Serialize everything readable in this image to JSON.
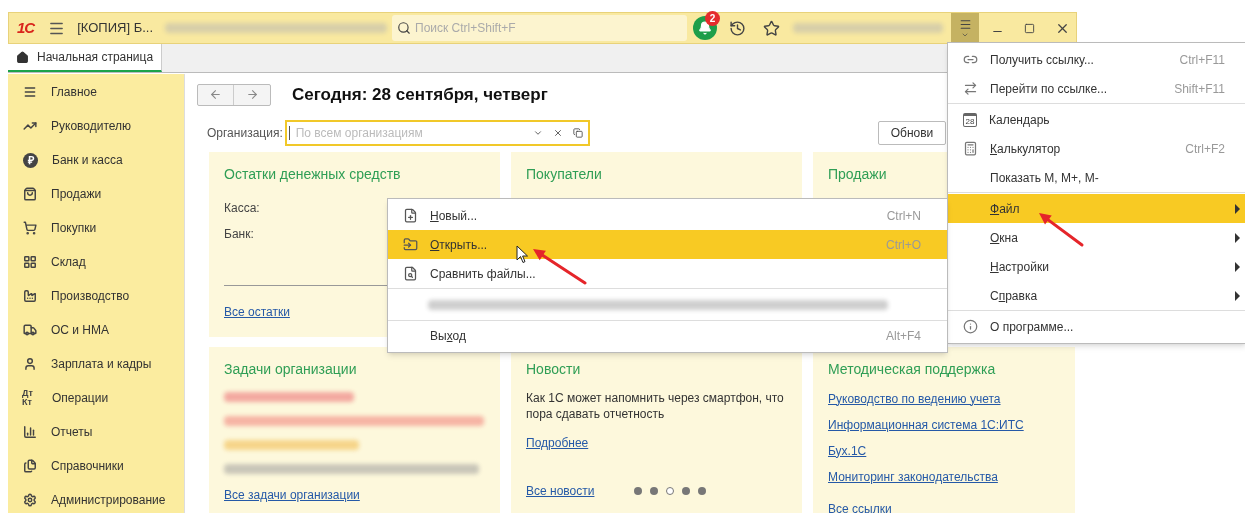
{
  "titlebar": {
    "logo": "1С",
    "title": "[КОПИЯ] Б...",
    "search": {
      "placeholder": "Поиск Ctrl+Shift+F"
    },
    "notifications": "2",
    "menu_open": true
  },
  "tabs": [
    {
      "label": "Начальная страница",
      "selected": true
    }
  ],
  "sidebar": {
    "items": [
      {
        "label": "Главное"
      },
      {
        "label": "Руководителю"
      },
      {
        "label": "Банк и касса",
        "icon_text": "₽"
      },
      {
        "label": "Продажи"
      },
      {
        "label": "Покупки"
      },
      {
        "label": "Склад"
      },
      {
        "label": "Производство"
      },
      {
        "label": "ОС и НМА"
      },
      {
        "label": "Зарплата и кадры"
      },
      {
        "label": "Операции",
        "icon_text": "Дт Кт"
      },
      {
        "label": "Отчеты"
      },
      {
        "label": "Справочники"
      },
      {
        "label": "Администрирование"
      }
    ]
  },
  "page": {
    "title": "Сегодня: 28 сентября, четверг",
    "org_label": "Организация:",
    "org_placeholder": "По всем организациям",
    "refresh_button": "Обнови",
    "cards": [
      {
        "kind": "balances",
        "title": "Остатки денежных средств",
        "lines": [
          "Касса:",
          "Банк:"
        ],
        "footer_link": "Все остатки"
      },
      {
        "kind": "plain",
        "title": "Покупатели"
      },
      {
        "kind": "plain",
        "title": "Продажи"
      },
      {
        "kind": "tasks",
        "title": "Задачи организации",
        "footer_link": "Все задачи организации"
      },
      {
        "kind": "news",
        "title": "Новости",
        "text": "Как 1С может напомнить через смартфон, что пора сдавать отчетность",
        "more_link": "Подробнее",
        "footer_link": "Все новости",
        "dots": [
          {
            "selected": false
          },
          {
            "selected": false
          },
          {
            "selected": true
          },
          {
            "selected": false
          },
          {
            "selected": false
          }
        ]
      },
      {
        "kind": "links",
        "title": "Методическая поддержка",
        "links": [
          "Руководство по ведению учета",
          "Информационная система 1С:ИТС",
          "Бух.1С",
          "Мониторинг законодательства"
        ],
        "footer_link": "Все ссылки"
      }
    ]
  },
  "main_menu": {
    "groups": [
      [
        {
          "pre": "Получить ссылку...",
          "shortcut": "Ctrl+F11",
          "submenu": false,
          "selected": false
        },
        {
          "pre": "Перейти по ссылке...",
          "shortcut": "Shift+F11",
          "submenu": false,
          "selected": false
        }
      ],
      [
        {
          "pre": "Кален",
          "key": "д",
          "post": "арь",
          "icon_text": "28",
          "submenu": false,
          "selected": false
        },
        {
          "key": "К",
          "post": "алькулятор",
          "shortcut": "Ctrl+F2",
          "submenu": false,
          "selected": false
        },
        {
          "pre": "Показать M, M+, M-",
          "submenu": false,
          "selected": false
        }
      ],
      [
        {
          "key": "Ф",
          "post": "айл",
          "submenu": true,
          "selected": true
        },
        {
          "key": "О",
          "post": "кна",
          "submenu": true,
          "selected": false
        },
        {
          "key": "Н",
          "post": "астройки",
          "submenu": true,
          "selected": false
        },
        {
          "pre": "С",
          "key": "п",
          "post": "равка",
          "submenu": true,
          "selected": false
        }
      ],
      [
        {
          "pre": "О программе...",
          "submenu": false,
          "selected": false
        }
      ]
    ]
  },
  "file_menu": {
    "groups": [
      [
        {
          "key": "Н",
          "post": "овый...",
          "shortcut": "Ctrl+N",
          "selected": false
        },
        {
          "key": "О",
          "post": "ткрыть...",
          "shortcut": "Ctrl+O",
          "selected": true
        },
        {
          "pre": "Сравнить файлы...",
          "selected": false
        }
      ],
      [
        {
          "kind": "recent",
          "selected": false
        }
      ],
      [
        {
          "pre": "Вы",
          "key": "х",
          "post": "од",
          "shortcut": "Alt+F4",
          "selected": false
        }
      ]
    ]
  }
}
